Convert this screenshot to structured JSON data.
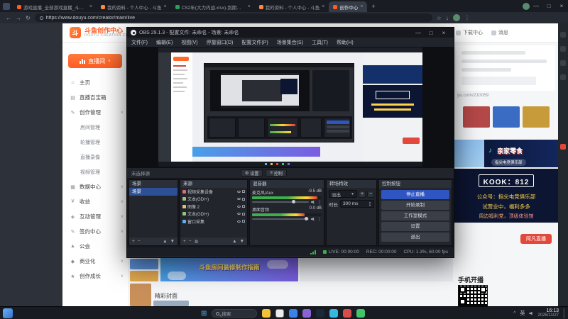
{
  "browser": {
    "tabs": [
      {
        "label": "游戏直播_全部游戏直播_斗鱼直播"
      },
      {
        "label": "我的资料 - 个人中心 - 斗鱼"
      },
      {
        "label": "CS2年(大力内战.xlsx)-到期图xls"
      },
      {
        "label": "我的资料 - 个人中心 - 斗鱼"
      },
      {
        "label": "创作中心"
      }
    ],
    "url": "https://www.douyu.com/creator/main/live"
  },
  "douyu": {
    "logo_title": "斗鱼创作中心",
    "logo_sub": "DOUYU CREATION CENTER",
    "header": {
      "download": "下载中心",
      "message": "消息"
    },
    "live_room_button": "直播间",
    "sidebar": [
      {
        "label": "主页"
      },
      {
        "label": "直播百宝箱"
      },
      {
        "label": "创作管理"
      },
      {
        "label": "房间管理"
      },
      {
        "label": "轮播管理"
      },
      {
        "label": "直播录像"
      },
      {
        "label": "视频管理"
      },
      {
        "label": "数据中心"
      },
      {
        "label": "收益"
      },
      {
        "label": "互动管理"
      },
      {
        "label": "签约中心"
      },
      {
        "label": "公会"
      },
      {
        "label": "商业化"
      },
      {
        "label": "创作成长"
      }
    ],
    "promo": {
      "room_link": "yu.com/210059",
      "snack_brand": "亲家零食",
      "club_pill": "指尖电竞俱乐部",
      "kook_id": "KOOK：812",
      "kook_line1": "公众号：指尖电竞俱乐部",
      "kook_line2": "试营业中，福利多多",
      "kook_line3": "周边福利党，顶级体验馆",
      "live_badge": "阿凡直播"
    },
    "bottom": {
      "banner": "斗鱼房间装修制作指南",
      "phone_live": "手机开播",
      "cover_label": "精彩封面"
    }
  },
  "obs": {
    "title": "OBS 29.1.3 - 配置文件: 未命名 - 场景: 未命名",
    "menus": [
      "文件(F)",
      "编辑(E)",
      "视图(V)",
      "停靠窗口(D)",
      "配置文件(P)",
      "场景集合(S)",
      "工具(T)",
      "帮助(H)"
    ],
    "no_source_label": "未选择源",
    "preview_buttons": [
      {
        "label": "设置"
      },
      {
        "label": "控制"
      }
    ],
    "scenes": {
      "title": "场景",
      "items": [
        {
          "label": "场景"
        }
      ]
    },
    "sources": {
      "title": "来源",
      "items": [
        {
          "label": "视频采集设备"
        },
        {
          "label": "文本(GDI+)"
        },
        {
          "label": "图像 2"
        },
        {
          "label": "文本(GDI+)"
        },
        {
          "label": "窗口采集"
        }
      ]
    },
    "mixer": {
      "title": "混音器",
      "channels": [
        {
          "name": "麦克风/Aux",
          "db": "-9.5 dB"
        },
        {
          "name": "桌面音频",
          "db": "0.0 dB"
        }
      ]
    },
    "transitions": {
      "title": "转场特效",
      "selected": "淡出",
      "duration_label": "时长",
      "duration": "300 ms"
    },
    "controls": {
      "title": "控制按钮",
      "buttons": [
        {
          "label": "停止直播"
        },
        {
          "label": "开始录制"
        },
        {
          "label": "工作室模式"
        },
        {
          "label": "设置"
        },
        {
          "label": "退出"
        }
      ]
    },
    "status": {
      "live": "LIVE: 00:00:00",
      "rec": "REC: 00:00:00",
      "cpu": "CPU: 1.3%, 60.00 fps"
    }
  },
  "taskbar": {
    "search": "搜索",
    "lang": "英",
    "time": "16:13",
    "date": "2025/11/27"
  }
}
